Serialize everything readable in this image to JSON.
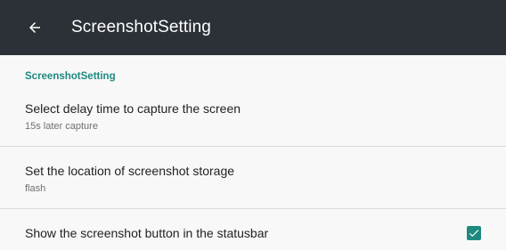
{
  "appbar": {
    "title": "ScreenshotSetting",
    "back_icon": "arrow-back-icon"
  },
  "section": {
    "header": "ScreenshotSetting"
  },
  "preferences": [
    {
      "title": "Select delay time to capture the screen",
      "summary": "15s later capture"
    },
    {
      "title": "Set the location of screenshot storage",
      "summary": "flash"
    },
    {
      "title": "Show the screenshot button in the statusbar",
      "checked": true,
      "checkbox_icon": "checkbox-checked-icon"
    }
  ],
  "colors": {
    "appbar": "#2b3137",
    "accent": "#1e8a7f",
    "background": "#f8f8f8"
  }
}
